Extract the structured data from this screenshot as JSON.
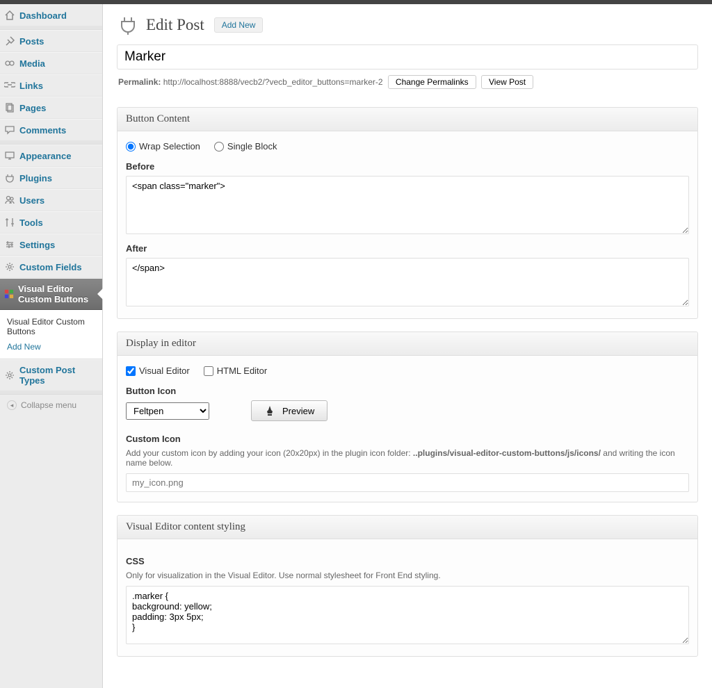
{
  "sidebar": {
    "items": [
      {
        "label": "Dashboard",
        "icon": "house-icon"
      },
      {
        "label": "Posts",
        "icon": "pin-icon"
      },
      {
        "label": "Media",
        "icon": "media-icon"
      },
      {
        "label": "Links",
        "icon": "link-icon"
      },
      {
        "label": "Pages",
        "icon": "pages-icon"
      },
      {
        "label": "Comments",
        "icon": "comment-icon"
      },
      {
        "label": "Appearance",
        "icon": "appearance-icon"
      },
      {
        "label": "Plugins",
        "icon": "plugin-icon"
      },
      {
        "label": "Users",
        "icon": "users-icon"
      },
      {
        "label": "Tools",
        "icon": "tools-icon"
      },
      {
        "label": "Settings",
        "icon": "settings-icon"
      },
      {
        "label": "Custom Fields",
        "icon": "gear-icon"
      },
      {
        "label": "Visual Editor Custom Buttons",
        "icon": "editor-icon"
      },
      {
        "label": "Custom Post Types",
        "icon": "gear-icon"
      }
    ],
    "submenu": {
      "item1": "Visual Editor Custom Buttons",
      "item2": "Add New"
    },
    "collapse": "Collapse menu"
  },
  "header": {
    "title": "Edit Post",
    "add_new": "Add New"
  },
  "post": {
    "title": "Marker",
    "permalink_label": "Permalink:",
    "permalink_url": "http://localhost:8888/vecb2/?vecb_editor_buttons=marker-2",
    "change_permalinks": "Change Permalinks",
    "view_post": "View Post"
  },
  "button_content": {
    "box_title": "Button Content",
    "wrap_label": "Wrap Selection",
    "single_label": "Single Block",
    "before_label": "Before",
    "before_value": "<span class=\"marker\">",
    "after_label": "After",
    "after_value": "</span>"
  },
  "display": {
    "box_title": "Display in editor",
    "visual_label": "Visual Editor",
    "html_label": "HTML Editor",
    "button_icon_label": "Button Icon",
    "icon_selected": "Feltpen",
    "preview_label": "Preview",
    "custom_icon_label": "Custom Icon",
    "custom_icon_hint_pre": "Add your custom icon by adding your icon (20x20px) in the plugin icon folder: ",
    "custom_icon_hint_path": "..plugins/visual-editor-custom-buttons/js/icons/",
    "custom_icon_hint_post": " and writing the icon name below.",
    "custom_icon_placeholder": "my_icon.png"
  },
  "styling": {
    "box_title": "Visual Editor content styling",
    "css_label": "CSS",
    "css_hint": "Only for visualization in the Visual Editor. Use normal stylesheet for Front End styling.",
    "css_value": ".marker {\nbackground: yellow;\npadding: 3px 5px;\n}"
  }
}
